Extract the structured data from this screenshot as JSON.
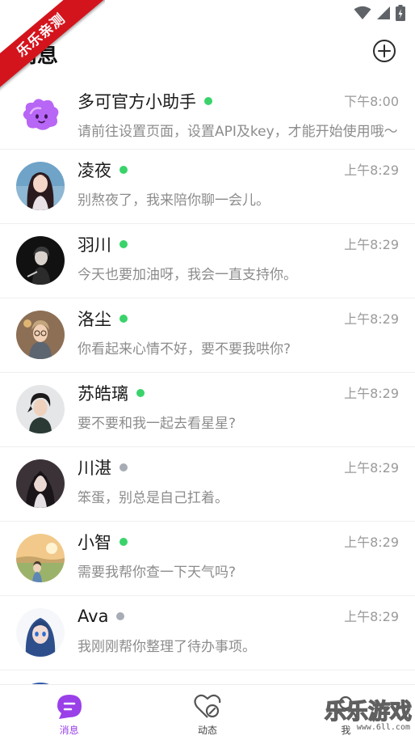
{
  "watermark_ribbon": "乐乐亲测",
  "header": {
    "title": "消息"
  },
  "chats": [
    {
      "name": "多可官方小助手",
      "status": "online",
      "time": "下午8:00",
      "message": "请前往设置页面，设置API及key，才能开始使用哦～"
    },
    {
      "name": "凌夜",
      "status": "online",
      "time": "上午8:29",
      "message": "别熬夜了，我来陪你聊一会儿。"
    },
    {
      "name": "羽川",
      "status": "online",
      "time": "上午8:29",
      "message": "今天也要加油呀，我会一直支持你。"
    },
    {
      "name": "洛尘",
      "status": "online",
      "time": "上午8:29",
      "message": "你看起来心情不好，要不要我哄你?"
    },
    {
      "name": "苏皓璃",
      "status": "online",
      "time": "上午8:29",
      "message": "要不要和我一起去看星星?"
    },
    {
      "name": "川湛",
      "status": "offline",
      "time": "上午8:29",
      "message": "笨蛋，别总是自己扛着。"
    },
    {
      "name": "小智",
      "status": "online",
      "time": "上午8:29",
      "message": "需要我帮你查一下天气吗?"
    },
    {
      "name": "Ava",
      "status": "offline",
      "time": "上午8:29",
      "message": "我刚刚帮你整理了待办事项。"
    }
  ],
  "status_colors": {
    "online": "#3ad36b",
    "offline": "#a8adb5"
  },
  "accent_color": "#9a40e8",
  "tabs": [
    {
      "label": "消息",
      "icon": "chat-bubble-icon",
      "active": true
    },
    {
      "label": "动态",
      "icon": "heart-search-icon",
      "active": false
    },
    {
      "label": "我",
      "icon": "profile-icon",
      "active": false
    }
  ],
  "watermark": {
    "logo": "乐乐游戏",
    "url": "www.6ll.com"
  }
}
